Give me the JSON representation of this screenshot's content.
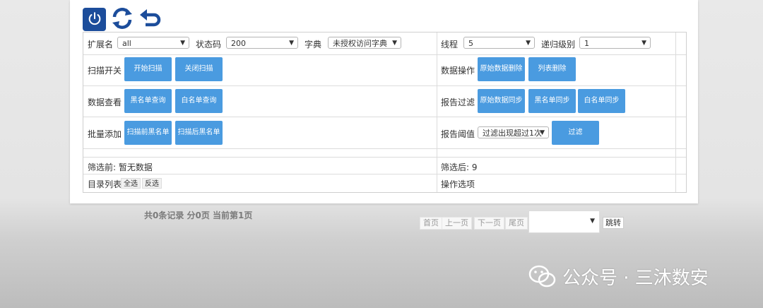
{
  "toolbar": {
    "power_icon": "power-icon",
    "refresh_icon": "refresh-icon",
    "undo_icon": "undo-icon",
    "accent": "#1c4d9b"
  },
  "filters": {
    "ext_label": "扩展名",
    "ext_value": "all",
    "status_label": "状态码",
    "status_value": "200",
    "dict_label": "字典",
    "dict_value": "未授权访问字典",
    "thread_label": "线程",
    "thread_value": "5",
    "recursion_label": "递归级别",
    "recursion_value": "1"
  },
  "rows": {
    "scan_switch": {
      "label": "扫描开关",
      "start": "开始扫描",
      "stop": "关闭扫描"
    },
    "data_ops": {
      "label": "数据操作",
      "delete_raw": "原始数据删除",
      "delete_list": "列表删除"
    },
    "data_view": {
      "label": "数据查看",
      "blacklist": "黑名单查询",
      "whitelist": "白名单查询"
    },
    "report_filter": {
      "label": "报告过滤",
      "sync_raw": "原始数据同步",
      "sync_black": "黑名单同步",
      "sync_white": "白名单同步"
    },
    "batch_add": {
      "label": "批量添加",
      "pre_black": "扫描前黑名单",
      "post_black": "扫描后黑名单"
    },
    "report_threshold": {
      "label": "报告阈值",
      "select_value": "过滤出现超过1次",
      "filter_btn": "过滤"
    }
  },
  "summary": {
    "before": "筛选前: 暂无数据",
    "after": "筛选后: 9"
  },
  "dir_list": {
    "label": "目录列表",
    "select_all": "全选",
    "invert": "反选"
  },
  "ops_label": "操作选项",
  "pagination": {
    "info": "共0条记录 分0页 当前第1页",
    "first": "首页",
    "prev": "上一页",
    "next": "下一页",
    "last": "尾页",
    "jump": "跳转"
  },
  "watermark": {
    "text": "公众号 · 三沐数安",
    "icon": "wechat-icon"
  },
  "colors": {
    "button": "#4a9be0",
    "button_text": "#ffffff"
  }
}
